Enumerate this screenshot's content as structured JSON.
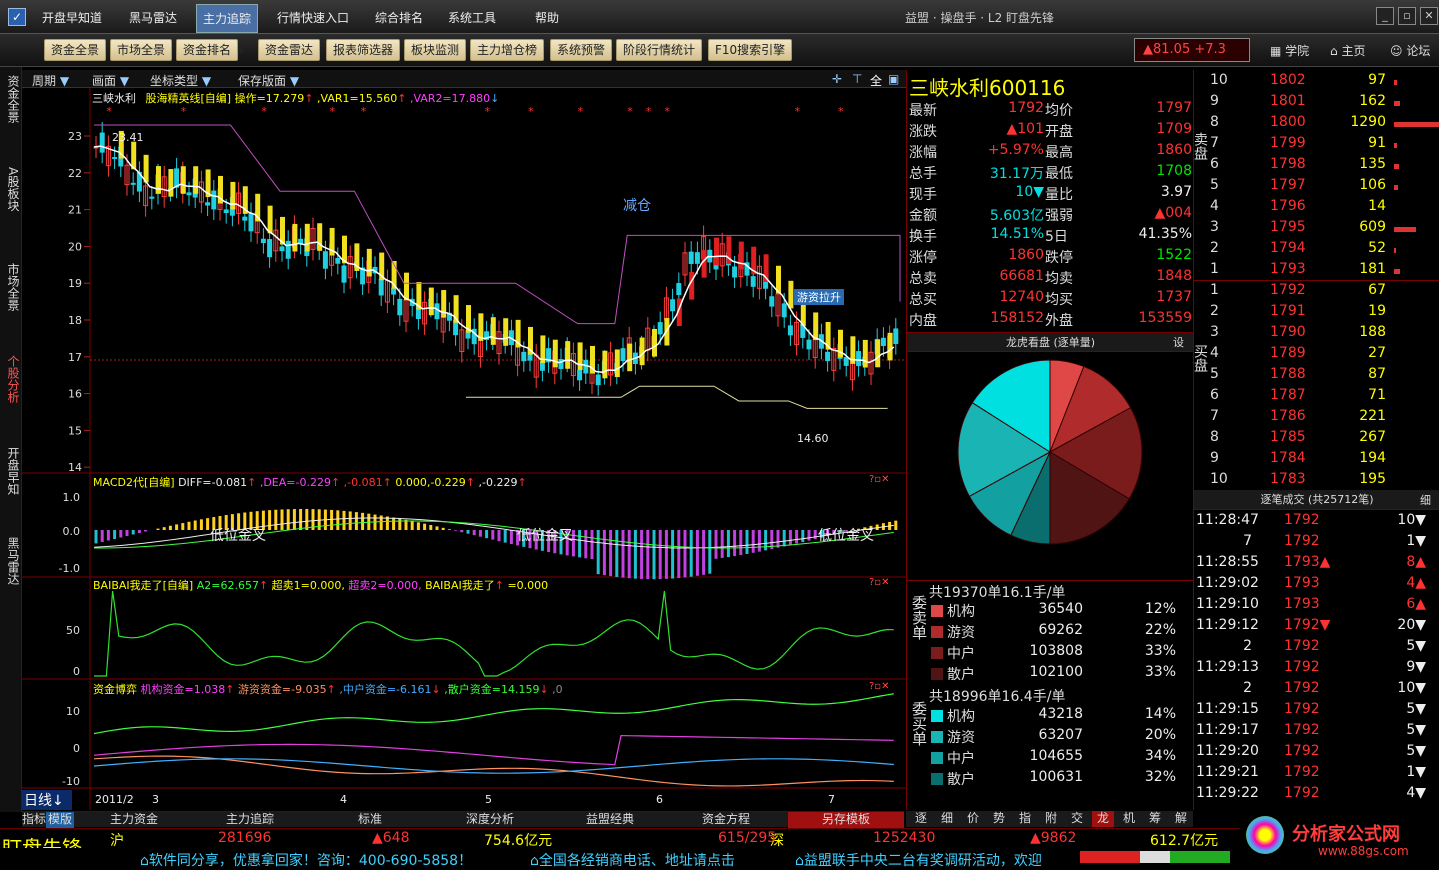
{
  "menu": [
    "开盘早知道",
    "黑马雷达",
    "主力追踪",
    "行情快速入口",
    "综合排名",
    "系统工具",
    "帮助"
  ],
  "window_title": "益盟 · 操盘手 · L2 盯盘先锋",
  "toolbar": [
    "资金全景",
    "市场全景",
    "资金排名",
    "资金雷达",
    "报表筛选器",
    "板块监测",
    "主力增仓榜",
    "系统预警",
    "阶段行情统计",
    "F10搜索引擎"
  ],
  "index_quote": "▲81.05 +7.3",
  "top_links": [
    "学院",
    "主页",
    "论坛"
  ],
  "left_tabs": [
    "资金全景",
    "A股板块",
    "市场全景",
    "个股分析",
    "开盘早知",
    "黑马雷达"
  ],
  "chart_bar": [
    "周期",
    "画面",
    "坐标类型",
    "保存版面"
  ],
  "main_header": {
    "name": "三峡水利",
    "ind": "股海精英线[自编]",
    "op": "操作=17.279",
    "var1": ",VAR1=15.560",
    "var2": ",VAR2=17.880"
  },
  "price_ticks": [
    "23",
    "22",
    "21",
    "20",
    "19",
    "18",
    "17",
    "16",
    "15",
    "14"
  ],
  "annotations": {
    "high": "23.41",
    "low": "14.60",
    "reduce": "减仓",
    "hot": "游资拉升"
  },
  "macd": {
    "header": "MACD2代[自编]",
    "diff": "DIFF=-0.081",
    "dea": ",DEA=-0.229",
    "v1": ",-0.081",
    "v2": "0.000,-0.229",
    "v3": ",-0.229",
    "ticks": [
      "1.0",
      "0.0",
      "-1.0"
    ],
    "label": "低位金叉"
  },
  "baibai": {
    "header": "BAIBAI我走了[自编]",
    "a2": "A2=62.657",
    "c1": "超卖1=0.000,",
    "c2": "超卖2=0.000,",
    "c3": "BAIBAI我走了",
    "c4": "=0.000",
    "ticks": [
      "50",
      "0"
    ]
  },
  "fund": {
    "header": "资金博弈",
    "jg": "机构资金=1.038",
    "yz": "游资资金=-9.035",
    "zh": ",中户资金=-6.161",
    "sh": ",散户资金=14.159",
    "z": ",0",
    "ticks": [
      "10",
      "0",
      "-10"
    ]
  },
  "xaxis": {
    "period": "日线",
    "labels": [
      "2011/2",
      "3",
      "4",
      "5",
      "6",
      "7"
    ]
  },
  "quote": {
    "name": "三峡水利",
    "code": "600116",
    "rows": [
      [
        "最新",
        "1792",
        "均价",
        "1797"
      ],
      [
        "涨跌",
        "▲101",
        "开盘",
        "1709"
      ],
      [
        "涨幅",
        "+5.97%",
        "最高",
        "1860"
      ],
      [
        "总手",
        "31.17万",
        "最低",
        "1708"
      ],
      [
        "现手",
        "10▼",
        "量比",
        "3.97"
      ],
      [
        "金额",
        "5.603亿",
        "强弱",
        "▲004"
      ],
      [
        "换手",
        "14.51%",
        "5日",
        "41.35%"
      ],
      [
        "涨停",
        "1860",
        "跌停",
        "1522"
      ],
      [
        "总卖",
        "66681",
        "均卖",
        "1848"
      ],
      [
        "总买",
        "12740",
        "均买",
        "1737"
      ],
      [
        "内盘",
        "158152",
        "外盘",
        "153559"
      ]
    ],
    "lh_title": "龙虎看盘 (逐单量)",
    "lh_set": "设",
    "sell": {
      "total": "共19370单16.1手/单",
      "rows": [
        [
          "机构",
          "36540",
          "12%"
        ],
        [
          "游资",
          "69262",
          "22%"
        ],
        [
          "中户",
          "103808",
          "33%"
        ],
        [
          "散户",
          "102100",
          "33%"
        ]
      ]
    },
    "buy": {
      "total": "共18996单16.4手/单",
      "rows": [
        [
          "机构",
          "43218",
          "14%"
        ],
        [
          "游资",
          "63207",
          "20%"
        ],
        [
          "中户",
          "104655",
          "34%"
        ],
        [
          "散户",
          "100631",
          "32%"
        ]
      ]
    },
    "sell_label": "委卖单",
    "buy_label": "委买单",
    "pie": [
      {
        "v": 12,
        "c": "#e04848"
      },
      {
        "v": 22,
        "c": "#b02c2c"
      },
      {
        "v": 33,
        "c": "#7a1c1c"
      },
      {
        "v": 33,
        "c": "#501414"
      },
      {
        "v": 14,
        "c": "#0a6e6e"
      },
      {
        "v": 20,
        "c": "#13a0a0"
      },
      {
        "v": 34,
        "c": "#1ab4b4"
      },
      {
        "v": 32,
        "c": "#00e0e0"
      }
    ]
  },
  "book": {
    "sell_label": "卖盘",
    "buy_label": "买盘",
    "sell": [
      [
        "10",
        "1802",
        "97"
      ],
      [
        "9",
        "1801",
        "162"
      ],
      [
        "8",
        "1800",
        "1290"
      ],
      [
        "7",
        "1799",
        "91"
      ],
      [
        "6",
        "1798",
        "135"
      ],
      [
        "5",
        "1797",
        "106"
      ],
      [
        "4",
        "1796",
        "14"
      ],
      [
        "3",
        "1795",
        "609"
      ],
      [
        "2",
        "1794",
        "52"
      ],
      [
        "1",
        "1793",
        "181"
      ]
    ],
    "buy": [
      [
        "1",
        "1792",
        "67"
      ],
      [
        "2",
        "1791",
        "19"
      ],
      [
        "3",
        "1790",
        "188"
      ],
      [
        "4",
        "1789",
        "27"
      ],
      [
        "5",
        "1788",
        "87"
      ],
      [
        "6",
        "1787",
        "71"
      ],
      [
        "7",
        "1786",
        "221"
      ],
      [
        "8",
        "1785",
        "267"
      ],
      [
        "9",
        "1784",
        "194"
      ],
      [
        "10",
        "1783",
        "195"
      ]
    ]
  },
  "trades": {
    "title": "逐笔成交 (共25712笔)",
    "detail": "细",
    "rows": [
      [
        "11:28:47",
        "1792",
        "10▼"
      ],
      [
        "7",
        "1792",
        "1▼"
      ],
      [
        "11:28:55",
        "1793▲",
        "8▲"
      ],
      [
        "11:29:02",
        "1793",
        "4▲"
      ],
      [
        "11:29:10",
        "1793",
        "6▲"
      ],
      [
        "11:29:12",
        "1792▼",
        "20▼"
      ],
      [
        "2",
        "1792",
        "5▼"
      ],
      [
        "11:29:13",
        "1792",
        "9▼"
      ],
      [
        "2",
        "1792",
        "10▼"
      ],
      [
        "11:29:15",
        "1792",
        "5▼"
      ],
      [
        "11:29:17",
        "1792",
        "5▼"
      ],
      [
        "11:29:20",
        "1792",
        "5▼"
      ],
      [
        "11:29:21",
        "1792",
        "1▼"
      ],
      [
        "11:29:22",
        "1792",
        "4▼"
      ]
    ]
  },
  "bottom_tabs": [
    "指标",
    "模版",
    "主力资金",
    "主力追踪",
    "标准",
    "深度分析",
    "益盟经典",
    "资金方程",
    "另存模板"
  ],
  "right_tabs": [
    "逐",
    "细",
    "价",
    "势",
    "指",
    "附",
    "交",
    "龙",
    "机",
    "筹",
    "解"
  ],
  "status": {
    "brand": "盯盘先锋",
    "sh": "沪",
    "sh_v": "281696",
    "sh_ch": "▲648",
    "sh_amt": "754.6亿元",
    "updown": "615/295",
    "sz": "深",
    "sz_v": "1252430",
    "sz_ch": "▲9862",
    "sz_amt": "612.7亿元",
    "news1": "软件同分享，优惠拿回家！咨询：400-690-5858！",
    "news2": "全国各经销商电话、地址请点击",
    "news3": "益盟联手中央二台有奖调研活动，欢迎",
    "logo": "分析家公式网",
    "logo_url": "www.88gs.com"
  }
}
